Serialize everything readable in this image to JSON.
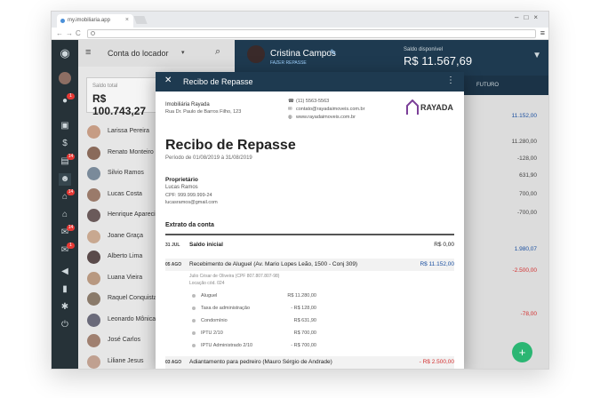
{
  "browser": {
    "tab_title": "my.imobiliaria.app",
    "url": ""
  },
  "leftpanel": {
    "account_selector": "Conta do locador",
    "saldo_label": "Saldo total",
    "saldo_value": "R$ 100.743,27",
    "people": [
      "Larissa Pereira",
      "Renato Monteiro",
      "Silvio Ramos",
      "Lucas Costa",
      "Henrique Aparecido",
      "Joane Graça",
      "Alberto Lima",
      "Luana Vieira",
      "Raquel Conquista",
      "Leonardo Mônica",
      "José Carlos",
      "Liliane Jesus"
    ]
  },
  "rail_badges": [
    "1",
    "14",
    "14",
    "14",
    "1"
  ],
  "header": {
    "user_name": "Cristina Campos",
    "user_sub": "FAZER REPASSE",
    "saldo_label": "Saldo disponível",
    "saldo_value": "R$ 11.567,69",
    "column_label": "FUTURO"
  },
  "right_values": [
    {
      "v": "11.152,00",
      "c": "#1a4fa0"
    },
    {
      "v": "11.280,00",
      "c": "#444"
    },
    {
      "v": "-128,00",
      "c": "#444"
    },
    {
      "v": "631,90",
      "c": "#444"
    },
    {
      "v": "700,00",
      "c": "#444"
    },
    {
      "v": "-700,00",
      "c": "#444"
    },
    {
      "v": "1.980,07",
      "c": "#1a4fa0"
    },
    {
      "v": "-2.500,00",
      "c": "#d32f2f"
    },
    {
      "v": "-78,00",
      "c": "#d32f2f"
    }
  ],
  "modal": {
    "title": "Recibo de Repasse",
    "company": "Imobiliária Rayada",
    "address": "Rua Dr. Paulo de Barros Filho, 123",
    "phone": "(11) 5563-5563",
    "email": "contato@rayadaimoveis.com.br",
    "site": "www.rayadaimoveis.com.br",
    "logo": "RAYADA",
    "heading": "Recibo de Repasse",
    "period": "Período de 01/08/2019 à 31/08/2019",
    "owner_title": "Proprietário",
    "owner_name": "Lucas Ramos",
    "owner_cpf": "CPF: 999.999.999-24",
    "owner_email": "lucasramos@gmail.com",
    "extract_title": "Extrato da conta",
    "rows": [
      {
        "date": "31 JUL",
        "desc": "Saldo inicial",
        "amount": "R$ 0,00"
      },
      {
        "date": "05 AGO",
        "desc": "Recebimento de Aluguel (Av. Mario Lopes Leão, 1500 - Conj 309)",
        "amount": "R$ 11.152,00"
      },
      {
        "date": "03 AGO",
        "desc": "Adiantamento para pedreiro (Mauro Sérgio de Andrade)",
        "amount": "- R$ 2.500,00"
      }
    ],
    "tenant": "Julio César de Oliveira (CPF 807.807.807-98)",
    "tenant_note": "Locação cód. 024",
    "breakdown": [
      {
        "name": "Aluguel",
        "amount": "R$ 11.280,00"
      },
      {
        "name": "Taxa de administração",
        "amount": "- R$ 128,00"
      },
      {
        "name": "Condomínio",
        "amount": "R$ 631,90"
      },
      {
        "name": "IPTU 2/10",
        "amount": "R$ 700,00"
      },
      {
        "name": "IPTU Administrado 2/10",
        "amount": "- R$ 700,00"
      }
    ]
  }
}
